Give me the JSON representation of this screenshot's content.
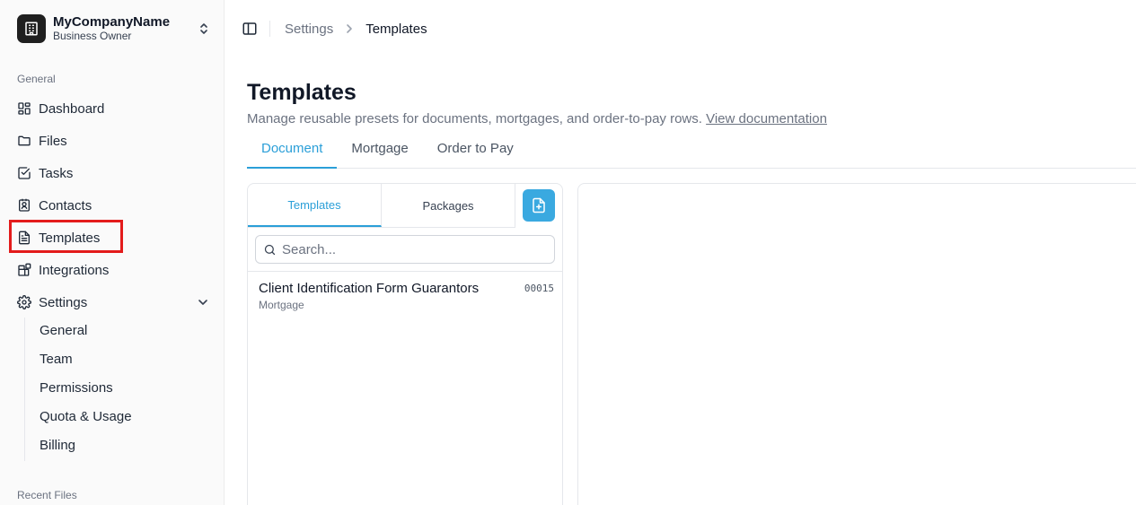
{
  "org": {
    "name": "MyCompanyName",
    "role": "Business Owner"
  },
  "sidebar": {
    "general_label": "General",
    "items": [
      {
        "label": "Dashboard",
        "icon": "dashboard-icon"
      },
      {
        "label": "Files",
        "icon": "folder-icon"
      },
      {
        "label": "Tasks",
        "icon": "checkbox-icon"
      },
      {
        "label": "Contacts",
        "icon": "contact-icon"
      },
      {
        "label": "Templates",
        "icon": "document-icon"
      },
      {
        "label": "Integrations",
        "icon": "blocks-icon"
      },
      {
        "label": "Settings",
        "icon": "gear-icon"
      }
    ],
    "settings_subitems": [
      "General",
      "Team",
      "Permissions",
      "Quota & Usage",
      "Billing"
    ],
    "recent_label": "Recent Files"
  },
  "breadcrumb": {
    "parent": "Settings",
    "current": "Templates"
  },
  "page": {
    "title": "Templates",
    "description": "Manage reusable presets for documents, mortgages, and order-to-pay rows.",
    "doc_link": "View documentation"
  },
  "tabs": [
    "Document",
    "Mortgage",
    "Order to Pay"
  ],
  "list_panel": {
    "subtabs": [
      "Templates",
      "Packages"
    ],
    "search_placeholder": "Search...",
    "items": [
      {
        "title": "Client Identification Form Guarantors",
        "category": "Mortgage",
        "code": "00015"
      }
    ]
  },
  "colors": {
    "accent": "#2b9fd8",
    "highlight": "#e31b1b",
    "button": "#3aa9e0"
  }
}
